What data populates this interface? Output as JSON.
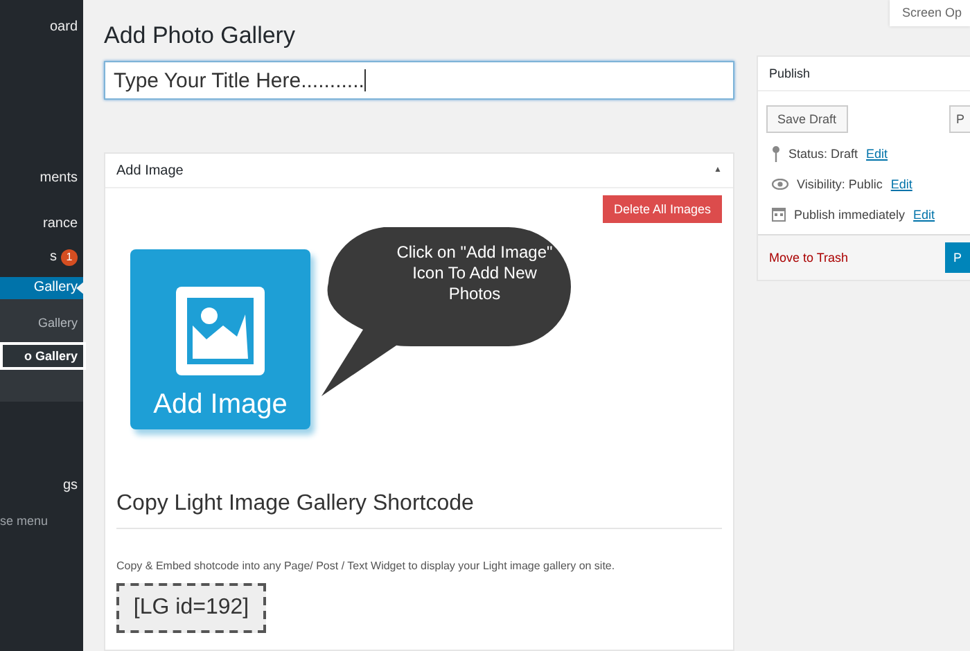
{
  "sidebar": {
    "items": [
      {
        "label": "oard",
        "kind": "item",
        "selected": false
      },
      {
        "label": "ments",
        "kind": "item",
        "selected": false
      },
      {
        "label": "rance",
        "kind": "item",
        "selected": false
      },
      {
        "label": "s",
        "kind": "item",
        "selected": false,
        "badge": "1"
      },
      {
        "label": "Gallery",
        "kind": "item",
        "selected": true
      },
      {
        "label": "Gallery",
        "kind": "sub",
        "selected": false
      },
      {
        "label": "o Gallery",
        "kind": "sub",
        "selected": true
      },
      {
        "label": "gs",
        "kind": "item",
        "selected": false
      },
      {
        "label": "se menu",
        "kind": "collapse",
        "selected": false
      }
    ]
  },
  "screen_options": "Screen Op",
  "page_title": "Add Photo Gallery",
  "title_field": {
    "value": "Type Your Title Here..........."
  },
  "add_image_box": {
    "title": "Add Image",
    "collapse_icon": "▲",
    "delete_button": "Delete All Images",
    "tile_label": "Add Image",
    "callout": "Click on \"Add Image\" Icon To Add New Photos",
    "shortcode_heading": "Copy Light Image Gallery Shortcode",
    "shortcode_help": "Copy & Embed shotcode into any Page/ Post / Text Widget to display your Light image gallery on site.",
    "shortcode": "[LG id=192]"
  },
  "publish": {
    "title": "Publish",
    "save_draft": "Save Draft",
    "preview": "P",
    "lines": [
      {
        "kind": "status",
        "text": "Status: Draft",
        "link": "Edit"
      },
      {
        "kind": "visibility",
        "text": "Visibility: Public",
        "link": "Edit"
      },
      {
        "kind": "schedule",
        "text": "Publish immediately",
        "link": "Edit"
      }
    ],
    "trash": "Move to Trash",
    "publish_button": "P"
  }
}
